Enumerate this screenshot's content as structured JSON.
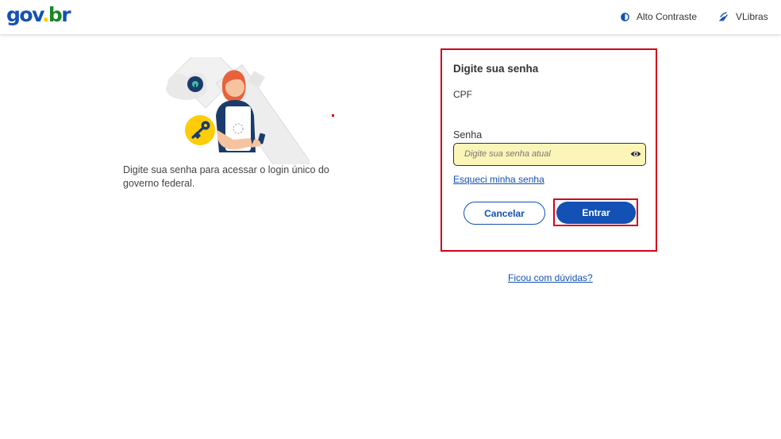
{
  "header": {
    "logo": {
      "part1": "gov",
      "part2": ".",
      "part3": "b",
      "part4": "r"
    },
    "contrast_label": "Alto Contraste",
    "vlibras_label": "VLibras"
  },
  "intro": {
    "text": "Digite sua senha para acessar o login único do governo federal."
  },
  "form": {
    "title": "Digite sua senha",
    "cpf_label": "CPF",
    "password_label": "Senha",
    "password_placeholder": "Digite sua senha atual",
    "password_value": "",
    "forgot_link": "Esqueci minha senha",
    "cancel_button": "Cancelar",
    "submit_button": "Entrar"
  },
  "help_link": "Ficou com dúvidas?",
  "colors": {
    "primary": "#1351b4",
    "highlight": "#d4001c",
    "input_bg": "#fbf5b8",
    "logo_yellow": "#ffcd07",
    "logo_green": "#168821"
  },
  "icons": {
    "contrast": "contrast-icon",
    "vlibras": "vlibras-hand-icon",
    "eye": "eye-icon",
    "key": "key-icon",
    "lock": "lock-icon"
  }
}
